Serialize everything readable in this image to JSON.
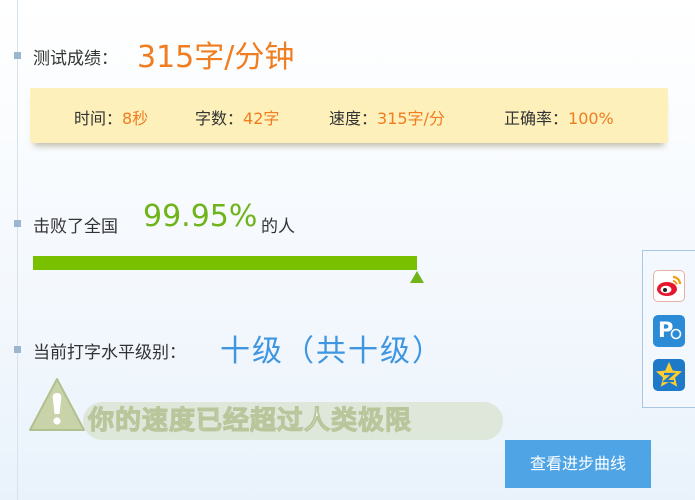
{
  "score": {
    "label": "测试成绩：",
    "value": "315字/分钟"
  },
  "stats": [
    {
      "label": "时间：",
      "value": "8秒"
    },
    {
      "label": "字数：",
      "value": "42字"
    },
    {
      "label": "速度：",
      "value": "315字/分"
    },
    {
      "label": "正确率：",
      "value": "100%"
    }
  ],
  "beat": {
    "label": "击败了全国",
    "value": "99.95%",
    "suffix": "的人",
    "fraction": 0.9995
  },
  "level": {
    "label": "当前打字水平级别：",
    "value": "十级（共十级）"
  },
  "warning": {
    "text": "你的速度已经超过人类极限"
  },
  "progress_button": {
    "label": "查看进步曲线"
  },
  "share": [
    {
      "icon": "sina-weibo-icon"
    },
    {
      "icon": "tencent-weibo-icon",
      "glyph": "P"
    },
    {
      "icon": "qzone-icon"
    }
  ],
  "colors": {
    "orange": "#f07d1f",
    "green": "#6fb419",
    "blue": "#3f96e0",
    "button": "#4fa4e6",
    "stats_bg": "#fdf0bb"
  }
}
